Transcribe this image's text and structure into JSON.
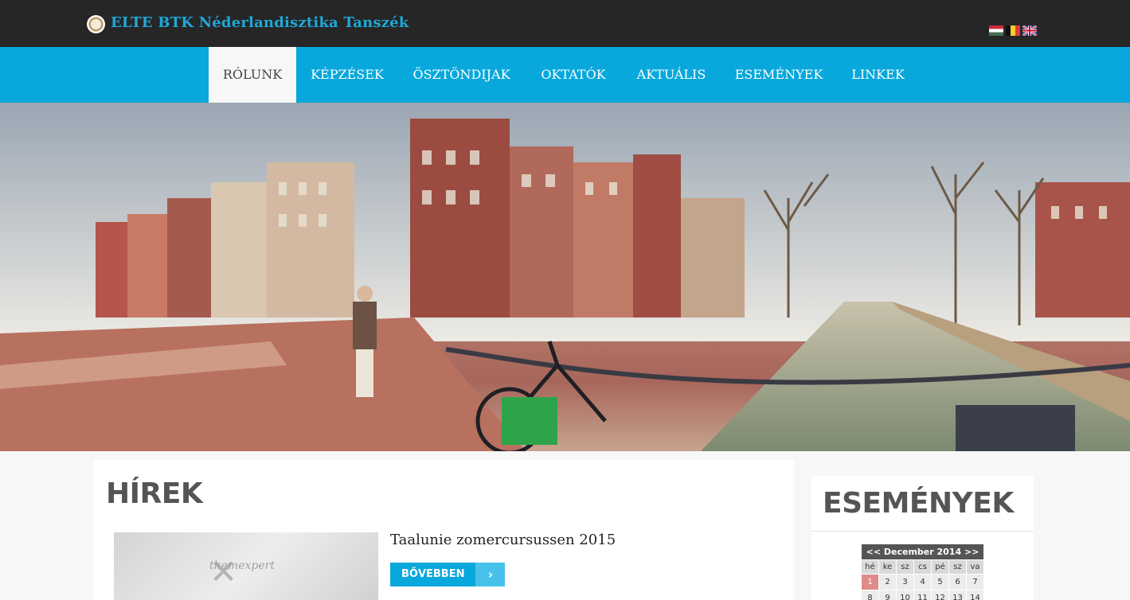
{
  "header": {
    "site_title": "ELTE BTK Néderlandisztika Tanszék",
    "logo": "university-seal-icon",
    "languages": [
      "hu-flag-icon",
      "be-flag-icon",
      "gb-flag-icon"
    ]
  },
  "nav": {
    "items": [
      {
        "label": "RÓLUNK",
        "active": true
      },
      {
        "label": "KÉPZÉSEK",
        "active": false
      },
      {
        "label": "ÖSZTÖNDIJAK",
        "active": false
      },
      {
        "label": "OKTATÓK",
        "active": false
      },
      {
        "label": "AKTUÁLIS",
        "active": false
      },
      {
        "label": "ESEMÉNYEK",
        "active": false
      },
      {
        "label": "LINKEK",
        "active": false
      }
    ]
  },
  "main": {
    "title": "HÍREK",
    "news": {
      "thumbnail_brand": "themexpert",
      "title": "Taalunie zomercursussen 2015",
      "more_label": "BŐVEBBEN",
      "more_icon": "chevron-right-icon"
    }
  },
  "sidebar": {
    "title": "ESEMÉNYEK",
    "calendar": {
      "header": "<< December 2014 >>",
      "weekdays": [
        "hé",
        "ke",
        "sz",
        "cs",
        "pé",
        "sz",
        "va"
      ],
      "week1": [
        "1",
        "2",
        "3",
        "4",
        "5",
        "6",
        "7"
      ],
      "week2": [
        "8",
        "9",
        "10",
        "11",
        "12",
        "13",
        "14"
      ],
      "today": "1"
    }
  },
  "colors": {
    "topbar": "#262626",
    "accent": "#08a8dc",
    "title_text": "#1fa8d8"
  }
}
